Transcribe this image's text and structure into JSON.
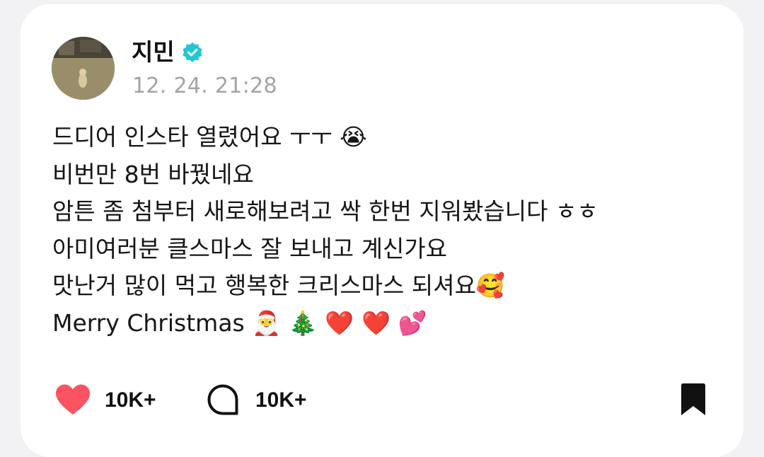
{
  "post": {
    "author": "지민",
    "timestamp": "12. 24. 21:28",
    "lines": [
      "드디어 인스타 열렸어요 ㅜㅜ 😭",
      "비번만 8번 바꿨네요",
      "암튼 좀 첨부터 새로해보려고 싹 한번 지워봤습니다 ㅎㅎ",
      "아미여러분 클스마스 잘 보내고 계신가요",
      "맛난거 많이 먹고 행복한 크리스마스 되셔요🥰",
      "Merry Christmas 🎅 🎄 ❤️ ❤️ 💕"
    ]
  },
  "actions": {
    "like_count": "10K+",
    "comment_count": "10K+"
  },
  "icons": {
    "verified": "verified-badge-icon",
    "like": "heart-icon",
    "comment": "comment-bubble-icon",
    "save": "bookmark-icon"
  },
  "colors": {
    "verified": "#22c7d6",
    "like": "#fb5362",
    "text": "#161616",
    "muted": "#a3a3a6"
  }
}
